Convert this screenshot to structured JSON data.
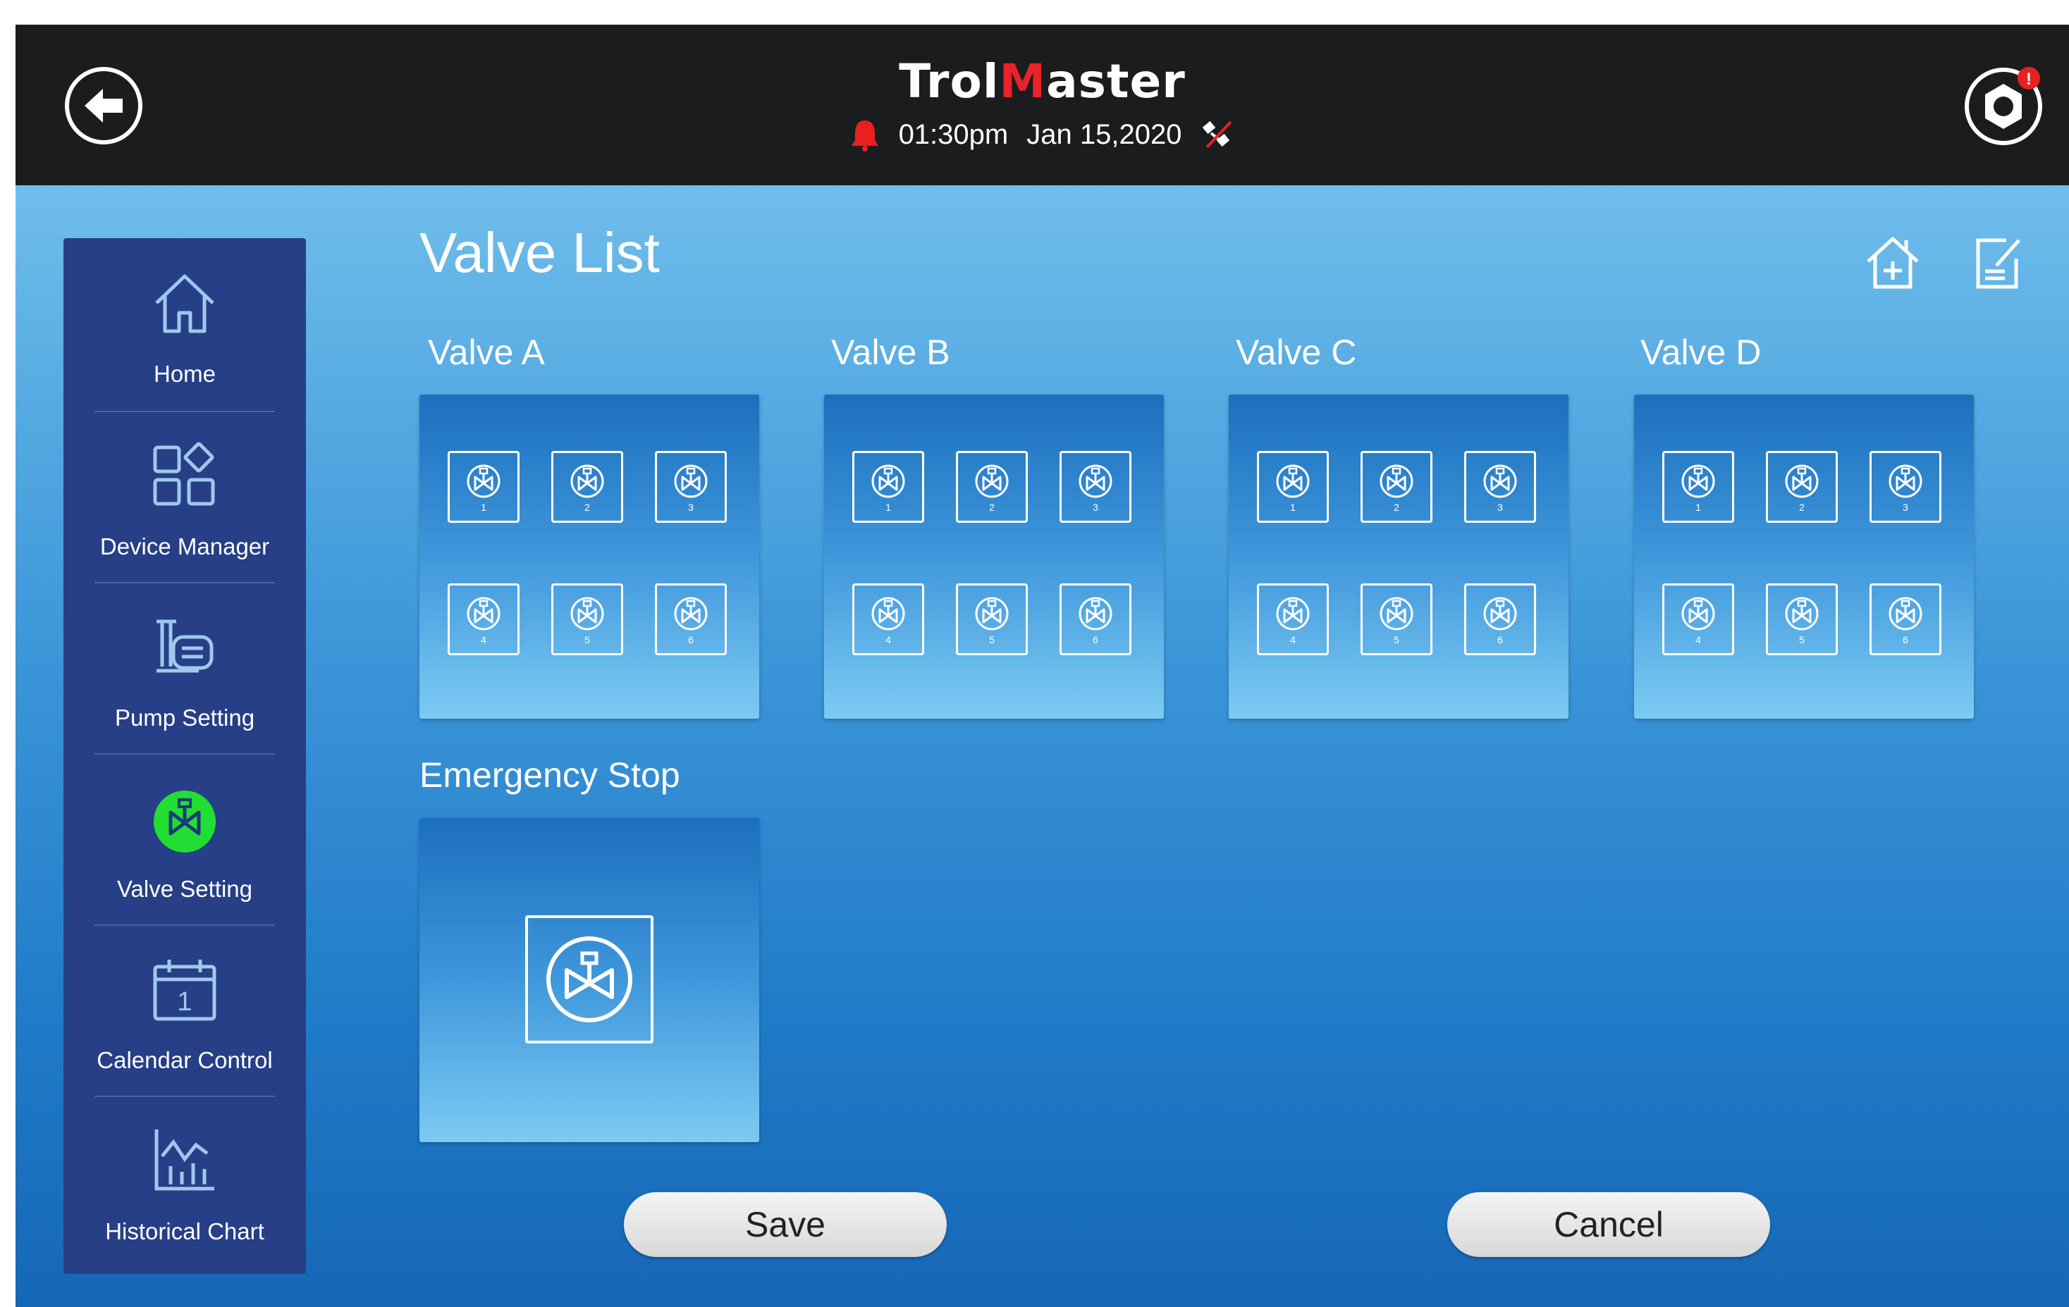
{
  "header": {
    "brand_prefix": "Trol",
    "brand_accent": "M",
    "brand_suffix": "aster",
    "time": "01:30pm",
    "date": "Jan 15,2020",
    "icons": [
      "back-arrow-icon",
      "alarm-bell-icon",
      "connection-off-icon",
      "settings-gear-icon"
    ],
    "notification_dot": "!"
  },
  "sidebar": {
    "items": [
      {
        "label": "Home",
        "icon": "home-icon",
        "active": false
      },
      {
        "label": "Device Manager",
        "icon": "device-grid-icon",
        "active": false
      },
      {
        "label": "Pump Setting",
        "icon": "pump-icon",
        "active": false
      },
      {
        "label": "Valve Setting",
        "icon": "valve-icon",
        "active": true
      },
      {
        "label": "Calendar Control",
        "icon": "calendar-icon",
        "active": false,
        "calendar_day": "1"
      },
      {
        "label": "Historical Chart",
        "icon": "chart-icon",
        "active": false
      }
    ]
  },
  "main": {
    "title": "Valve List",
    "actions": [
      "add-home-icon",
      "edit-note-icon"
    ],
    "groups": [
      {
        "label": "Valve A",
        "valves": [
          "1",
          "2",
          "3",
          "4",
          "5",
          "6"
        ]
      },
      {
        "label": "Valve B",
        "valves": [
          "1",
          "2",
          "3",
          "4",
          "5",
          "6"
        ]
      },
      {
        "label": "Valve C",
        "valves": [
          "1",
          "2",
          "3",
          "4",
          "5",
          "6"
        ]
      },
      {
        "label": "Valve D",
        "valves": [
          "1",
          "2",
          "3",
          "4",
          "5",
          "6"
        ]
      }
    ],
    "emergency": {
      "label": "Emergency Stop"
    }
  },
  "footer": {
    "save_label": "Save",
    "cancel_label": "Cancel"
  },
  "colors": {
    "topbar": "#1b1c1e",
    "sidebar": "#263f86",
    "brand_accent": "#e8232a",
    "active_indicator": "#22dd33",
    "alarm": "#e82020"
  }
}
